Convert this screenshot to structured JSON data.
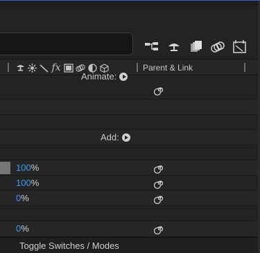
{
  "toolbar": {
    "search_placeholder": "",
    "icons": [
      "composition-flowchart-icon",
      "shy-layers-icon",
      "frame-blending-icon",
      "motion-blur-icon",
      "graph-editor-icon"
    ]
  },
  "header": {
    "switch_icons": [
      "shy-icon",
      "collapse-icon",
      "quality-icon",
      "fx-icon",
      "frame-blend-icon",
      "motion-blur-icon",
      "adjustment-layer-icon",
      "3d-layer-icon"
    ],
    "fx_label": "fx",
    "parent_link_label": "Parent & Link"
  },
  "rows": [
    {
      "type": "animate",
      "label": "Animate:",
      "has_spiral": true
    },
    {
      "type": "empty"
    },
    {
      "type": "empty"
    },
    {
      "type": "add",
      "label": "Add:"
    },
    {
      "type": "empty"
    },
    {
      "type": "value",
      "value": "100",
      "unit": "%",
      "has_spiral": true,
      "has_chip": true
    },
    {
      "type": "value",
      "value": "100",
      "unit": "%",
      "has_spiral": true
    },
    {
      "type": "value",
      "value": "0",
      "unit": "%",
      "has_spiral": true
    },
    {
      "type": "empty"
    },
    {
      "type": "value",
      "value": "0",
      "unit": "%",
      "has_spiral": true
    }
  ],
  "footer": {
    "label": "Toggle Switches / Modes"
  },
  "colors": {
    "value_blue": "#3f9bff",
    "background": "#232323",
    "accent_border": "#3a5fc7"
  }
}
